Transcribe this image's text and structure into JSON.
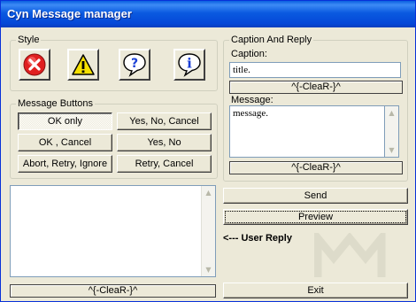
{
  "window": {
    "title": "Cyn Message manager"
  },
  "style_group": {
    "legend": "Style",
    "icons": [
      "error-icon",
      "warning-icon",
      "question-icon",
      "info-icon"
    ]
  },
  "buttons_group": {
    "legend": "Message Buttons",
    "ok_only": "OK only",
    "yes_no_cancel": "Yes, No, Cancel",
    "ok_cancel": "OK , Cancel",
    "yes_no": "Yes, No",
    "abort_retry_ignore": "Abort, Retry, Ignore",
    "retry_cancel": "Retry, Cancel",
    "selected": "OK only"
  },
  "caption_group": {
    "legend": "Caption And Reply",
    "caption_label": "Caption:",
    "caption_value": "title.",
    "message_label": "Message:",
    "message_value": "message.",
    "clear_label": "^{-CleaR-}^"
  },
  "output": {
    "clear_label": "^{-CleaR-}^"
  },
  "actions": {
    "send": "Send",
    "preview": "Preview",
    "exit": "Exit",
    "user_reply": "<--- User Reply"
  },
  "colors": {
    "titlebar": "#0a5ae0",
    "face": "#ece9d8",
    "error": "#e02020",
    "warning": "#f5e000",
    "question": "#1a3fd6",
    "info": "#1a3fd6"
  }
}
